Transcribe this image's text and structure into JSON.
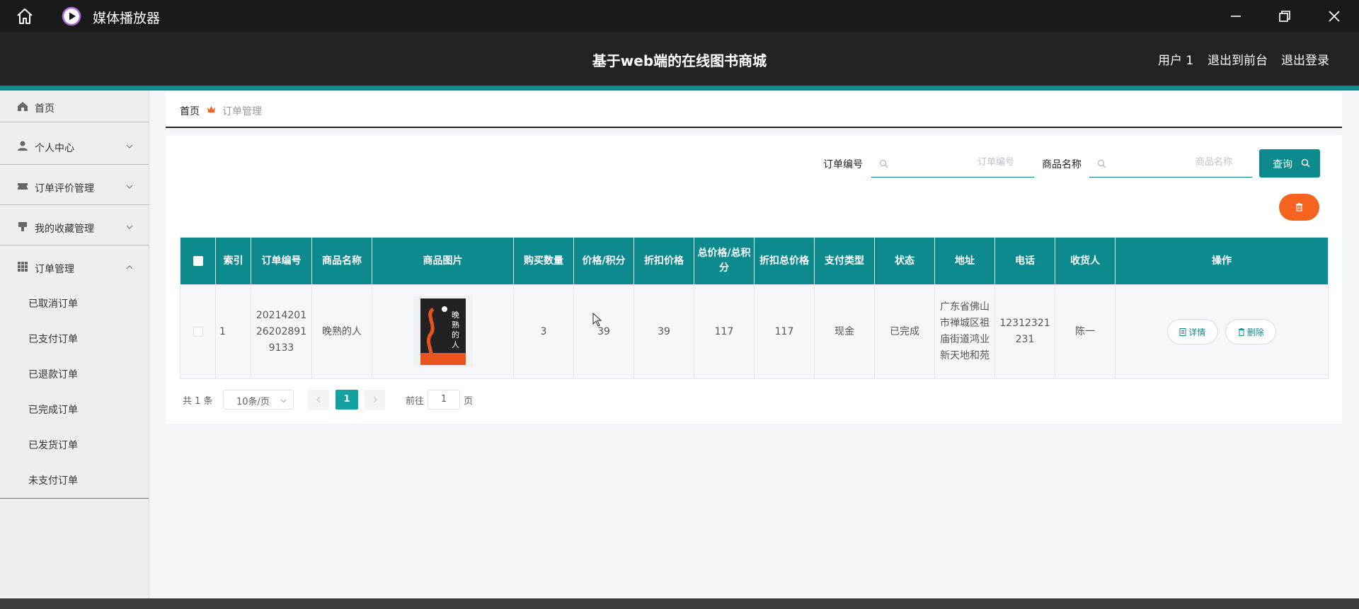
{
  "player": {
    "title": "媒体播放器",
    "icons": [
      "home-icon",
      "play-icon",
      "minimize-icon",
      "restore-icon",
      "close-icon"
    ]
  },
  "header": {
    "title": "基于web端的在线图书商城",
    "user": "用户 1",
    "to_front": "退出到前台",
    "logout": "退出登录"
  },
  "sidebar": {
    "home": "首页",
    "personal": "个人中心",
    "review": "订单评价管理",
    "favorites": "我的收藏管理",
    "orders": "订单管理",
    "sub": [
      "已取消订单",
      "已支付订单",
      "已退款订单",
      "已完成订单",
      "已发货订单",
      "未支付订单"
    ]
  },
  "breadcrumb": {
    "home": "首页",
    "current": "订单管理"
  },
  "filters": {
    "order_no_label": "订单编号",
    "order_no_placeholder": "订单编号",
    "product_label": "商品名称",
    "product_placeholder": "商品名称",
    "query": "查询"
  },
  "table": {
    "headers": [
      "索引",
      "订单编号",
      "商品名称",
      "商品图片",
      "购买数量",
      "价格/积分",
      "折扣价格",
      "总价格/总积分",
      "折扣总价格",
      "支付类型",
      "状态",
      "地址",
      "电话",
      "收货人",
      "操作"
    ],
    "rows": [
      {
        "index": "1",
        "order_no": "20214201262028919133",
        "product": "晚熟的人",
        "cover_text": "晚熟的人",
        "quantity": "3",
        "price": "39",
        "discount_price": "39",
        "total": "117",
        "discount_total": "117",
        "pay_type": "现金",
        "status": "已完成",
        "address": "广东省佛山市禅城区祖庙街道鸿业新天地和苑",
        "phone": "12312321231",
        "receiver": "陈一",
        "detail": "详情",
        "delete": "删除"
      }
    ]
  },
  "pagination": {
    "total": "共 1 条",
    "page_size": "10条/页",
    "current": "1",
    "goto": "前往",
    "goto_value": "1",
    "page_unit": "页"
  },
  "colors": {
    "accent": "#0d8a8e",
    "danger": "#f5631f",
    "header": "#232323"
  }
}
